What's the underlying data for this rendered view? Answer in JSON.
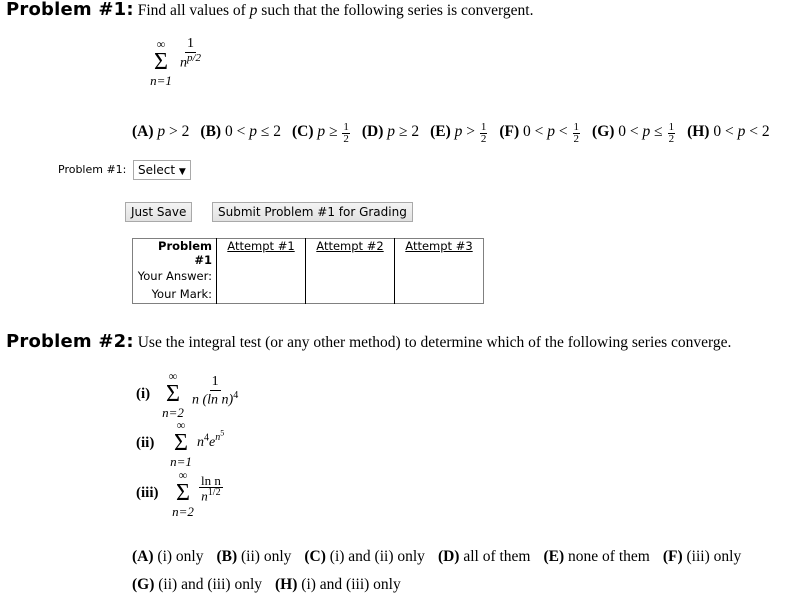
{
  "problem1": {
    "title": "Problem #1:",
    "description_pre": "Find all values of ",
    "description_var": "p",
    "description_post": " such that the following series is convergent.",
    "series": {
      "upper": "∞",
      "sigma": "Σ",
      "lower": "n=1",
      "numerator": "1",
      "den_base": "n",
      "den_exp": "p/2"
    },
    "options": [
      {
        "letter": "(A)",
        "pre": "",
        "var": "p",
        "rel": " > ",
        "val": "2",
        "frac": null
      },
      {
        "letter": "(B)",
        "pre": "0 < ",
        "var": "p",
        "rel": " ≤ ",
        "val": "2",
        "frac": null
      },
      {
        "letter": "(C)",
        "pre": "",
        "var": "p",
        "rel": " ≥ ",
        "val": "",
        "frac": {
          "num": "1",
          "den": "2"
        }
      },
      {
        "letter": "(D)",
        "pre": "",
        "var": "p",
        "rel": " ≥ ",
        "val": "2",
        "frac": null
      },
      {
        "letter": "(E)",
        "pre": "",
        "var": "p",
        "rel": " > ",
        "val": "",
        "frac": {
          "num": "1",
          "den": "2"
        }
      },
      {
        "letter": "(F)",
        "pre": "0 < ",
        "var": "p",
        "rel": " < ",
        "val": "",
        "frac": {
          "num": "1",
          "den": "2"
        }
      },
      {
        "letter": "(G)",
        "pre": "0 < ",
        "var": "p",
        "rel": " ≤ ",
        "val": "",
        "frac": {
          "num": "1",
          "den": "2"
        }
      },
      {
        "letter": "(H)",
        "pre": "0 < ",
        "var": "p",
        "rel": " < ",
        "val": "2",
        "frac": null
      }
    ],
    "answer_label": "Problem #1:",
    "select_value": "Select",
    "select_arrow": "▼",
    "just_save_label": "Just Save",
    "submit_label": "Submit Problem #1 for Grading",
    "attempts_table": {
      "header": "Problem #1",
      "row_labels": [
        "Your Answer:",
        "Your Mark:"
      ],
      "attempts": [
        "Attempt #1",
        "Attempt #2",
        "Attempt #3"
      ]
    }
  },
  "problem2": {
    "title": "Problem #2:",
    "description": "Use the integral test (or any other method) to determine which of the following series converge.",
    "series": [
      {
        "label": "(i)",
        "upper": "∞",
        "lower": "n=2",
        "sigma": "Σ",
        "numerator": "1",
        "denominator": "n (ln n)",
        "den_exp": "4"
      },
      {
        "label": "(ii)",
        "upper": "∞",
        "lower": "n=1",
        "sigma": "Σ",
        "term_base": "n",
        "term_exp1": "4",
        "term_e": "e",
        "term_exp2_base": "n",
        "term_exp2_exp": "5"
      },
      {
        "label": "(iii)",
        "upper": "∞",
        "lower": "n=2",
        "sigma": "Σ",
        "numerator": "ln n",
        "den_base": "n",
        "den_exp": "1/2"
      }
    ],
    "options_row1": [
      {
        "letter": "(A)",
        "text": "(i) only"
      },
      {
        "letter": "(B)",
        "text": "(ii) only"
      },
      {
        "letter": "(C)",
        "text": "(i) and (ii) only"
      },
      {
        "letter": "(D)",
        "text": "all of them"
      },
      {
        "letter": "(E)",
        "text": "none of them"
      },
      {
        "letter": "(F)",
        "text": "(iii) only"
      }
    ],
    "options_row2": [
      {
        "letter": "(G)",
        "text": "(ii) and (iii) only"
      },
      {
        "letter": "(H)",
        "text": "(i) and (iii) only"
      }
    ]
  }
}
